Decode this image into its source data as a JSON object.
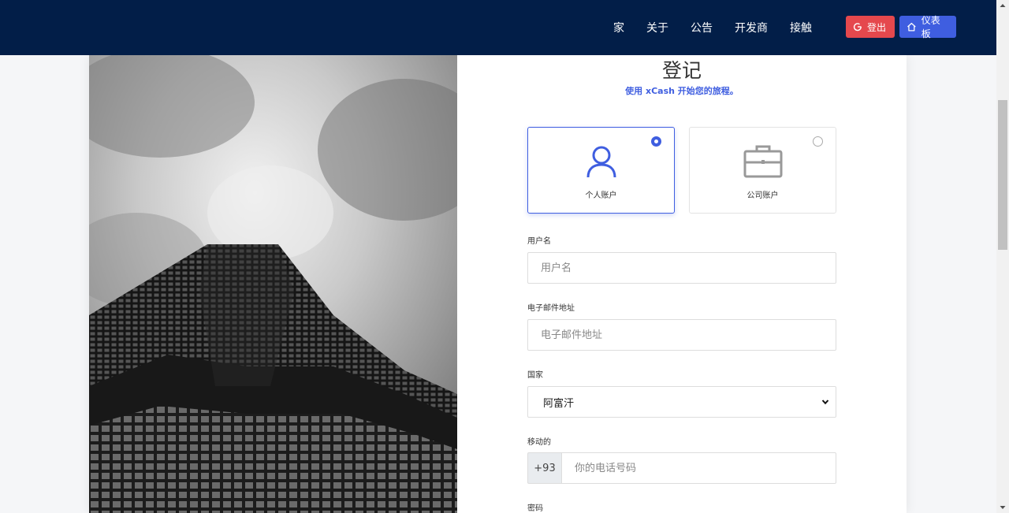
{
  "nav": {
    "links": [
      "家",
      "关于",
      "公告",
      "开发商",
      "接触"
    ],
    "logout_label": "登出",
    "dashboard_label": "仪表板"
  },
  "form": {
    "title": "登记",
    "subtitle": "使用 xCash 开始您的旅程。",
    "account_types": [
      {
        "label": "个人账户",
        "icon": "user-icon",
        "selected": true
      },
      {
        "label": "公司账户",
        "icon": "briefcase-icon",
        "selected": false
      }
    ],
    "username": {
      "label": "用户名",
      "placeholder": "用户名"
    },
    "email": {
      "label": "电子邮件地址",
      "placeholder": "电子邮件地址"
    },
    "country": {
      "label": "国家",
      "value": "阿富汗"
    },
    "mobile": {
      "label": "移动的",
      "prefix": "+93",
      "placeholder": "你的电话号码"
    },
    "password": {
      "label": "密码"
    }
  },
  "colors": {
    "navbar": "#021e48",
    "accent": "#3f5ee0",
    "logout": "#e5484d"
  }
}
